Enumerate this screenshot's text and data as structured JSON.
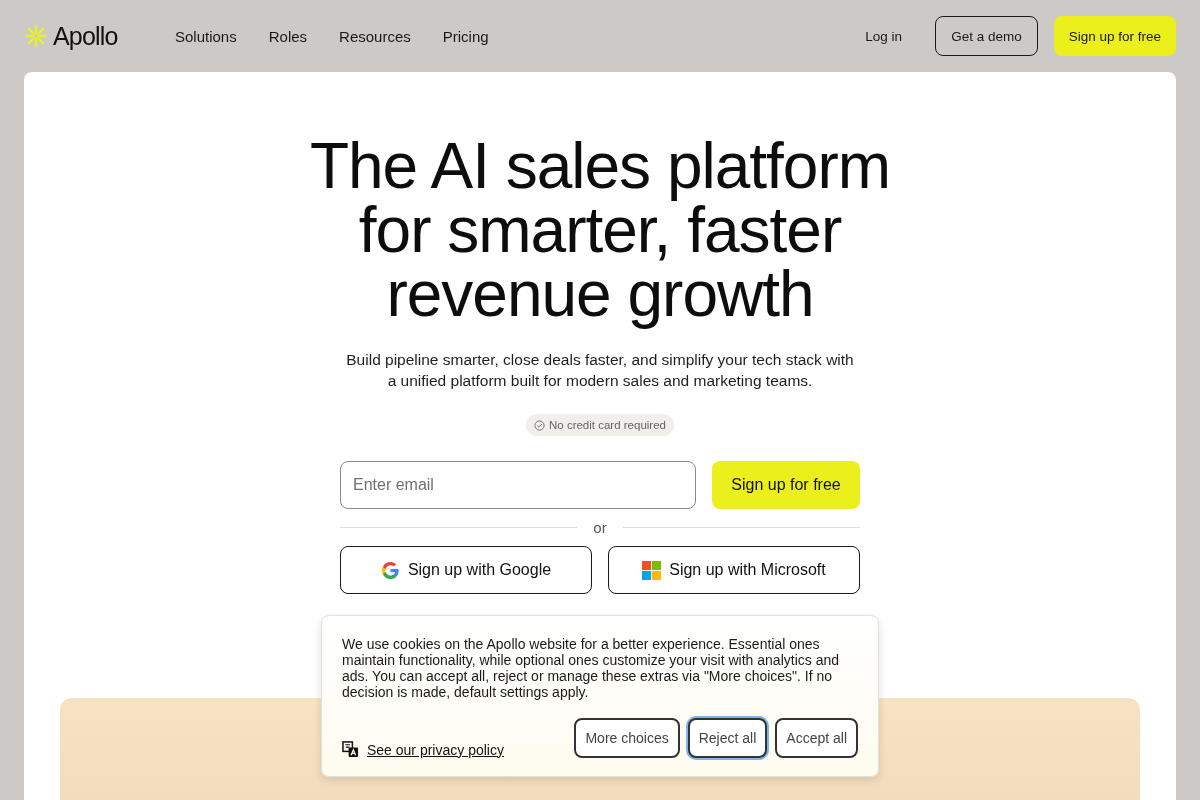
{
  "header": {
    "logo_text": "Apollo",
    "nav": [
      {
        "label": "Solutions"
      },
      {
        "label": "Roles"
      },
      {
        "label": "Resources"
      },
      {
        "label": "Pricing"
      }
    ],
    "actions": [
      {
        "kind": "link",
        "label": "Log in"
      },
      {
        "kind": "outline",
        "label": "Get a demo"
      },
      {
        "kind": "primary",
        "label": "Sign up for free"
      }
    ]
  },
  "hero": {
    "title": "The AI sales platform for smarter, faster revenue growth",
    "subtitle": "Build pipeline smarter, close deals faster, and simplify your tech stack with a unified platform built for modern sales and marketing teams.",
    "badge": "No credit card required",
    "email": {
      "placeholder": "Enter email"
    },
    "submit": "Sign up for free",
    "divider": "or",
    "social": [
      {
        "kind": "google",
        "label": "Sign up with Google"
      },
      {
        "kind": "microsoft",
        "label": "Sign up with Microsoft"
      }
    ]
  },
  "cookie_banner": {
    "text": "We use cookies on the Apollo website for a better experience. Essential ones maintain functionality, while optional ones customize your visit with analytics and ads. You can accept all, reject or manage these extras via \"More choices\". If no decision is made, default settings apply.",
    "privacy_link": "See our privacy policy",
    "buttons": [
      {
        "label": "More choices",
        "focused": false
      },
      {
        "label": "Reject all",
        "focused": true
      },
      {
        "label": "Accept all",
        "focused": false
      }
    ]
  }
}
